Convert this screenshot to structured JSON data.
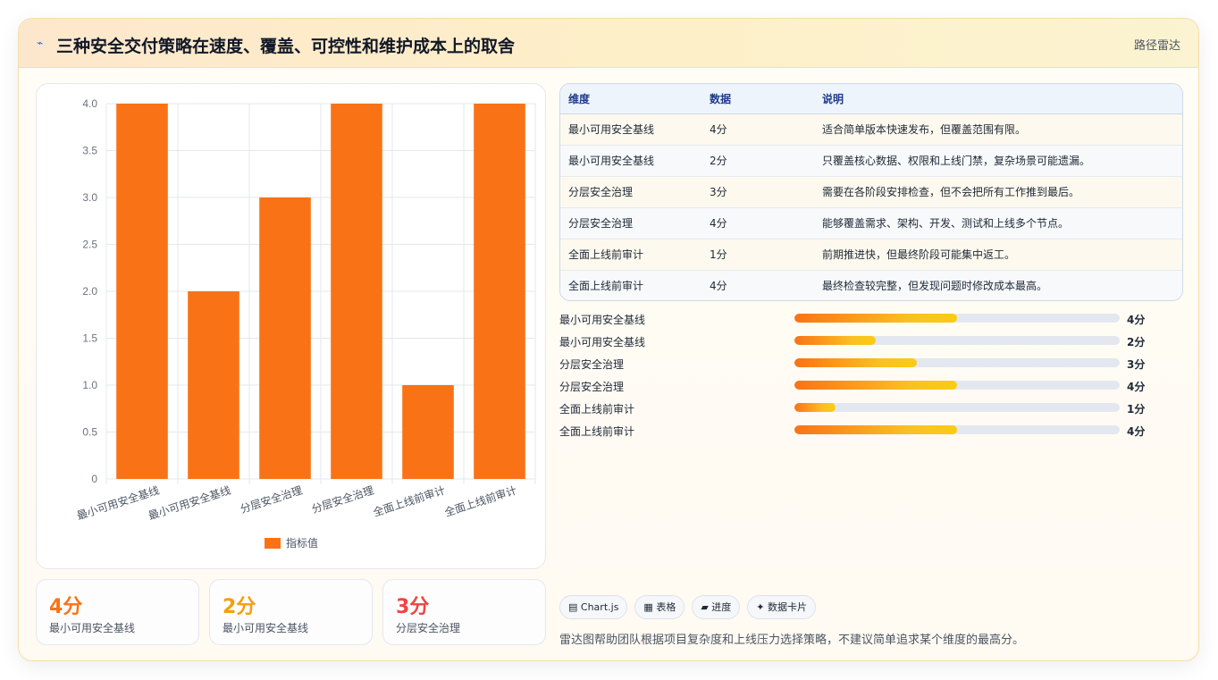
{
  "header": {
    "icon": "bolt-icon",
    "title": "三种安全交付策略在速度、覆盖、可控性和维护成本上的取舍",
    "tag": "路径雷达"
  },
  "chart_data": {
    "type": "bar",
    "categories": [
      "最小可用安全基线",
      "最小可用安全基线",
      "分层安全治理",
      "分层安全治理",
      "全面上线前审计",
      "全面上线前审计"
    ],
    "series": [
      {
        "name": "指标值",
        "values": [
          4,
          2,
          3,
          4,
          1,
          4
        ]
      }
    ],
    "ylim": [
      0,
      4
    ],
    "yticks": [
      "0",
      "0.5",
      "1.0",
      "1.5",
      "2.0",
      "2.5",
      "3.0",
      "3.5",
      "4.0"
    ],
    "color": "#f97316",
    "grid": true,
    "legend": "bottom"
  },
  "stats": [
    {
      "value": "4分",
      "label": "最小可用安全基线",
      "color": "#f97316"
    },
    {
      "value": "2分",
      "label": "最小可用安全基线",
      "color": "#f59e0b"
    },
    {
      "value": "3分",
      "label": "分层安全治理",
      "color": "#ef4444"
    }
  ],
  "table": {
    "headers": [
      "维度",
      "数据",
      "说明"
    ],
    "rows": [
      [
        "最小可用安全基线",
        "4分",
        "适合简单版本快速发布，但覆盖范围有限。"
      ],
      [
        "最小可用安全基线",
        "2分",
        "只覆盖核心数据、权限和上线门禁，复杂场景可能遗漏。"
      ],
      [
        "分层安全治理",
        "3分",
        "需要在各阶段安排检查，但不会把所有工作推到最后。"
      ],
      [
        "分层安全治理",
        "4分",
        "能够覆盖需求、架构、开发、测试和上线多个节点。"
      ],
      [
        "全面上线前审计",
        "1分",
        "前期推进快，但最终阶段可能集中返工。"
      ],
      [
        "全面上线前审计",
        "4分",
        "最终检查较完整，但发现问题时修改成本最高。"
      ]
    ]
  },
  "progress": [
    {
      "name": "最小可用安全基线",
      "score": "4分",
      "level": 0.5
    },
    {
      "name": "最小可用安全基线",
      "score": "2分",
      "level": 0.25
    },
    {
      "name": "分层安全治理",
      "score": "3分",
      "level": 0.375
    },
    {
      "name": "分层安全治理",
      "score": "4分",
      "level": 0.5
    },
    {
      "name": "全面上线前审计",
      "score": "1分",
      "level": 0.125
    },
    {
      "name": "全面上线前审计",
      "score": "4分",
      "level": 0.5
    }
  ],
  "chips": [
    {
      "icon": "chart-icon",
      "glyph": "▤",
      "label": "Chart.js"
    },
    {
      "icon": "table-icon",
      "glyph": "▦",
      "label": "表格"
    },
    {
      "icon": "progress-icon",
      "glyph": "▰",
      "label": "进度"
    },
    {
      "icon": "sparkle-icon",
      "glyph": "✦",
      "label": "数据卡片"
    }
  ],
  "note": "雷达图帮助团队根据项目复杂度和上线压力选择策略，不建议简单追求某个维度的最高分。"
}
